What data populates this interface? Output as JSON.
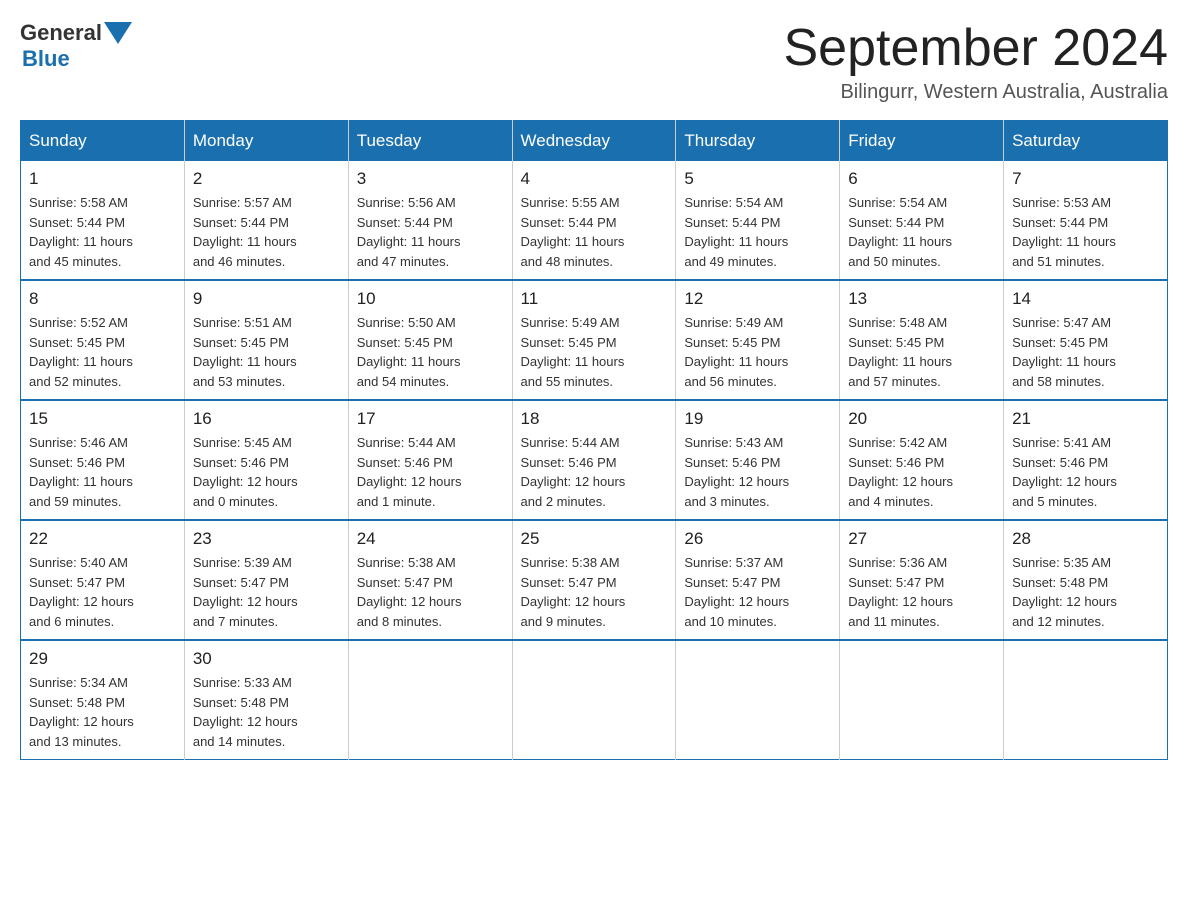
{
  "header": {
    "logo_text_general": "General",
    "logo_text_blue": "Blue",
    "month_title": "September 2024",
    "location": "Bilingurr, Western Australia, Australia"
  },
  "days_of_week": [
    "Sunday",
    "Monday",
    "Tuesday",
    "Wednesday",
    "Thursday",
    "Friday",
    "Saturday"
  ],
  "weeks": [
    [
      {
        "day": "1",
        "sunrise": "5:58 AM",
        "sunset": "5:44 PM",
        "daylight": "11 hours and 45 minutes."
      },
      {
        "day": "2",
        "sunrise": "5:57 AM",
        "sunset": "5:44 PM",
        "daylight": "11 hours and 46 minutes."
      },
      {
        "day": "3",
        "sunrise": "5:56 AM",
        "sunset": "5:44 PM",
        "daylight": "11 hours and 47 minutes."
      },
      {
        "day": "4",
        "sunrise": "5:55 AM",
        "sunset": "5:44 PM",
        "daylight": "11 hours and 48 minutes."
      },
      {
        "day": "5",
        "sunrise": "5:54 AM",
        "sunset": "5:44 PM",
        "daylight": "11 hours and 49 minutes."
      },
      {
        "day": "6",
        "sunrise": "5:54 AM",
        "sunset": "5:44 PM",
        "daylight": "11 hours and 50 minutes."
      },
      {
        "day": "7",
        "sunrise": "5:53 AM",
        "sunset": "5:44 PM",
        "daylight": "11 hours and 51 minutes."
      }
    ],
    [
      {
        "day": "8",
        "sunrise": "5:52 AM",
        "sunset": "5:45 PM",
        "daylight": "11 hours and 52 minutes."
      },
      {
        "day": "9",
        "sunrise": "5:51 AM",
        "sunset": "5:45 PM",
        "daylight": "11 hours and 53 minutes."
      },
      {
        "day": "10",
        "sunrise": "5:50 AM",
        "sunset": "5:45 PM",
        "daylight": "11 hours and 54 minutes."
      },
      {
        "day": "11",
        "sunrise": "5:49 AM",
        "sunset": "5:45 PM",
        "daylight": "11 hours and 55 minutes."
      },
      {
        "day": "12",
        "sunrise": "5:49 AM",
        "sunset": "5:45 PM",
        "daylight": "11 hours and 56 minutes."
      },
      {
        "day": "13",
        "sunrise": "5:48 AM",
        "sunset": "5:45 PM",
        "daylight": "11 hours and 57 minutes."
      },
      {
        "day": "14",
        "sunrise": "5:47 AM",
        "sunset": "5:45 PM",
        "daylight": "11 hours and 58 minutes."
      }
    ],
    [
      {
        "day": "15",
        "sunrise": "5:46 AM",
        "sunset": "5:46 PM",
        "daylight": "11 hours and 59 minutes."
      },
      {
        "day": "16",
        "sunrise": "5:45 AM",
        "sunset": "5:46 PM",
        "daylight": "12 hours and 0 minutes."
      },
      {
        "day": "17",
        "sunrise": "5:44 AM",
        "sunset": "5:46 PM",
        "daylight": "12 hours and 1 minute."
      },
      {
        "day": "18",
        "sunrise": "5:44 AM",
        "sunset": "5:46 PM",
        "daylight": "12 hours and 2 minutes."
      },
      {
        "day": "19",
        "sunrise": "5:43 AM",
        "sunset": "5:46 PM",
        "daylight": "12 hours and 3 minutes."
      },
      {
        "day": "20",
        "sunrise": "5:42 AM",
        "sunset": "5:46 PM",
        "daylight": "12 hours and 4 minutes."
      },
      {
        "day": "21",
        "sunrise": "5:41 AM",
        "sunset": "5:46 PM",
        "daylight": "12 hours and 5 minutes."
      }
    ],
    [
      {
        "day": "22",
        "sunrise": "5:40 AM",
        "sunset": "5:47 PM",
        "daylight": "12 hours and 6 minutes."
      },
      {
        "day": "23",
        "sunrise": "5:39 AM",
        "sunset": "5:47 PM",
        "daylight": "12 hours and 7 minutes."
      },
      {
        "day": "24",
        "sunrise": "5:38 AM",
        "sunset": "5:47 PM",
        "daylight": "12 hours and 8 minutes."
      },
      {
        "day": "25",
        "sunrise": "5:38 AM",
        "sunset": "5:47 PM",
        "daylight": "12 hours and 9 minutes."
      },
      {
        "day": "26",
        "sunrise": "5:37 AM",
        "sunset": "5:47 PM",
        "daylight": "12 hours and 10 minutes."
      },
      {
        "day": "27",
        "sunrise": "5:36 AM",
        "sunset": "5:47 PM",
        "daylight": "12 hours and 11 minutes."
      },
      {
        "day": "28",
        "sunrise": "5:35 AM",
        "sunset": "5:48 PM",
        "daylight": "12 hours and 12 minutes."
      }
    ],
    [
      {
        "day": "29",
        "sunrise": "5:34 AM",
        "sunset": "5:48 PM",
        "daylight": "12 hours and 13 minutes."
      },
      {
        "day": "30",
        "sunrise": "5:33 AM",
        "sunset": "5:48 PM",
        "daylight": "12 hours and 14 minutes."
      },
      null,
      null,
      null,
      null,
      null
    ]
  ],
  "labels": {
    "sunrise": "Sunrise:",
    "sunset": "Sunset:",
    "daylight": "Daylight:"
  }
}
